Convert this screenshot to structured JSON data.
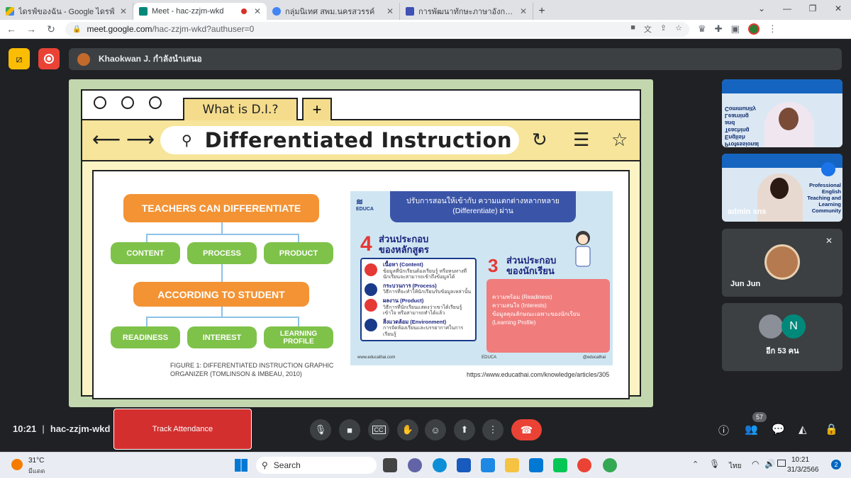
{
  "browser": {
    "tabs": [
      {
        "title": "ไดรฟ์ของฉัน - Google ไดรฟ์",
        "color": "#34a853"
      },
      {
        "title": "Meet - hac-zzjm-wkd",
        "color": "#00897b",
        "active": true
      },
      {
        "title": "กลุ่มนิเทศ สพม.นครสวรรค์",
        "color": "#4285f4"
      },
      {
        "title": "การพัฒนาทักษะภาษาอังกฤษ English",
        "color": "#3f51b5"
      }
    ],
    "url_domain": "meet.google.com",
    "url_path": "/hac-zzjm-wkd?authuser=0"
  },
  "meet": {
    "presenter_text": "Khaokwan J. กำลังนำเสนอ",
    "meeting_code": "hac-zzjm-wkd",
    "time": "10:21",
    "track_attendance": "Track Attendance",
    "people_count": "57",
    "participants": [
      {
        "name": "Jun Jun"
      },
      {
        "name": "admin sns"
      },
      {
        "name": "อีก 53 คน",
        "initial": "N"
      }
    ],
    "tile1_text": "Professional English Teaching and Learning Community",
    "tile2_text": "Professional English Teaching and Learning Community"
  },
  "slide": {
    "tab_label": "What is D.I.?",
    "search_text": "Differentiated Instruction",
    "teachers": "TEACHERS CAN DIFFERENTIATE",
    "content": "CONTENT",
    "process": "PROCESS",
    "product": "PRODUCT",
    "according": "ACCORDING TO STUDENT",
    "readiness": "READINESS",
    "interest": "INTEREST",
    "learning": "LEARNING PROFILE",
    "figure": "FIGURE 1: DIFFERENTIATED INSTRUCTION GRAPHIC ORGANIZER (TOMLINSON & IMBEAU, 2010)",
    "url": "https://www.educathai.com/knowledge/articles/305",
    "educa": {
      "logo": "EDUCA",
      "title": "ปรับการสอนให้เข้ากับ ความแตกต่างหลากหลาย (Differentiate) ผ่าน",
      "num4": "4",
      "h4": "ส่วนประกอบ ของหลักสูตร",
      "items": [
        {
          "h": "เนื้อหา (Content)",
          "d": "ข้อมูลที่นักเรียนต้องเรียนรู้ หรือหนทางที่นักเรียนจะสามารถเข้าถึงข้อมูลได้"
        },
        {
          "h": "กระบวนการ (Process)",
          "d": "วิธีการที่จะทำให้นักเรียนรับข้อมูลเหล่านั้น"
        },
        {
          "h": "ผลงาน (Product)",
          "d": "วิธีการที่นักเรียนแสดงว่าเขาได้เรียนรู้ เข้าใจ หรือสามารถทำได้แล้ว"
        },
        {
          "h": "สิ่งแวดล้อม (Environment)",
          "d": "การจัดห้องเรียนและบรรยากาศในการเรียนรู้"
        }
      ],
      "num3": "3",
      "h3": "ส่วนประกอบ ของนักเรียน",
      "student_items": [
        "ความพร้อม (Readiness)",
        "ความสนใจ (Interests)",
        "ข้อมูลคุณลักษณะเฉพาะของนักเรียน (Learning Profile)"
      ],
      "footer": [
        "www.educathai.com",
        "EDUCA",
        "@educathai"
      ]
    }
  },
  "taskbar": {
    "weather_temp": "31°C",
    "weather_text": "มีแดด",
    "search": "Search",
    "lang": "ไทย",
    "clock_time": "10:21",
    "clock_date": "31/3/2566",
    "notif": "2"
  }
}
